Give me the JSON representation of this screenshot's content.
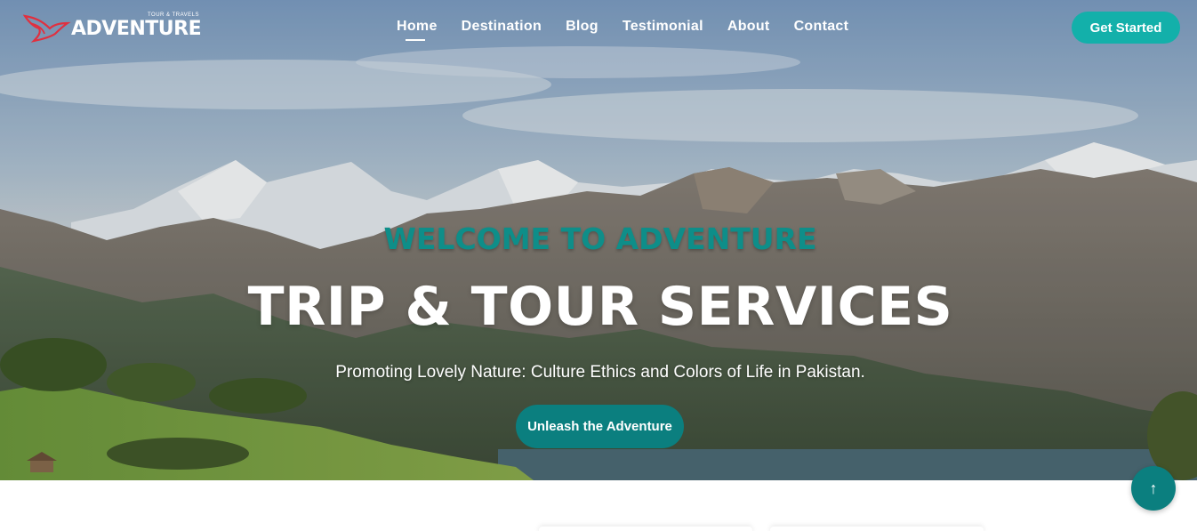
{
  "brand": {
    "name": "ADVENTURE",
    "tagline": "TOUR & TRAVELS"
  },
  "nav": {
    "items": [
      {
        "label": "Home",
        "active": true
      },
      {
        "label": "Destination",
        "active": false
      },
      {
        "label": "Blog",
        "active": false
      },
      {
        "label": "Testimonial",
        "active": false
      },
      {
        "label": "About",
        "active": false
      },
      {
        "label": "Contact",
        "active": false
      }
    ],
    "cta_label": "Get Started"
  },
  "hero": {
    "welcome": "WELCOME TO ADVENTURE",
    "headline": "TRIP & TOUR SERVICES",
    "subtitle": "Promoting Lovely Nature: Culture Ethics and Colors of Life in Pakistan.",
    "button_label": "Unleash the Adventure",
    "background": "mountain-landscape"
  },
  "back_to_top": {
    "icon": "arrow-up-icon",
    "glyph": "↑"
  },
  "colors": {
    "accent": "#13b0aa",
    "accent_dark": "#0b7f7f",
    "welcome_text": "#0e8e89",
    "logo_red": "#e0303f"
  }
}
